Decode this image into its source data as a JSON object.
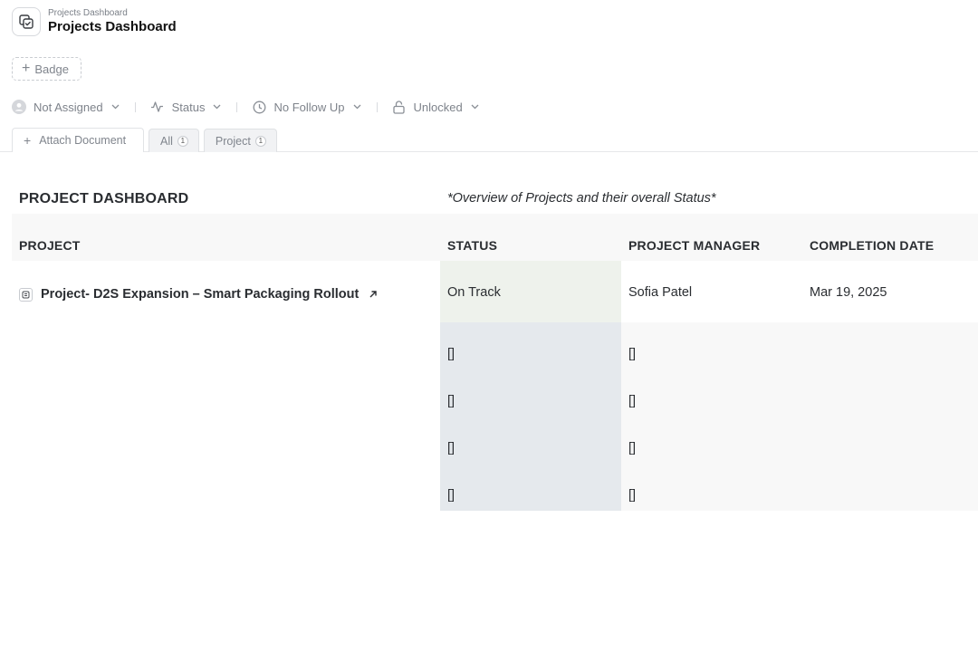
{
  "header": {
    "breadcrumb": "Projects Dashboard",
    "title": "Projects Dashboard"
  },
  "badge_button": {
    "label": "Badge"
  },
  "meta": {
    "assignee": "Not Assigned",
    "status": "Status",
    "follow_up": "No Follow Up",
    "lock": "Unlocked"
  },
  "tabs": {
    "attach_label": "Attach Document",
    "items": [
      {
        "label": "All",
        "count": "1"
      },
      {
        "label": "Project",
        "count": "1"
      }
    ]
  },
  "dashboard": {
    "title": "PROJECT DASHBOARD",
    "subtitle": "*Overview of Projects and their overall Status*",
    "columns": [
      "PROJECT",
      "STATUS",
      "PROJECT MANAGER",
      "COMPLETION DATE"
    ],
    "rows": [
      {
        "project": "Project- D2S Expansion – Smart Packaging Rollout",
        "status": "On Track",
        "manager": "Sofia Patel",
        "completion": "Mar 19, 2025"
      },
      {
        "project": "",
        "status": "[]",
        "manager": "[]",
        "completion": ""
      },
      {
        "project": "",
        "status": "[]",
        "manager": "[]",
        "completion": ""
      },
      {
        "project": "",
        "status": "[]",
        "manager": "[]",
        "completion": ""
      },
      {
        "project": "",
        "status": "[]",
        "manager": "[]",
        "completion": ""
      }
    ]
  },
  "colors": {
    "on_track_bg": "#eef2ec",
    "status_col_bg": "#e5e9ed",
    "header_bg": "#f8f8f8"
  }
}
